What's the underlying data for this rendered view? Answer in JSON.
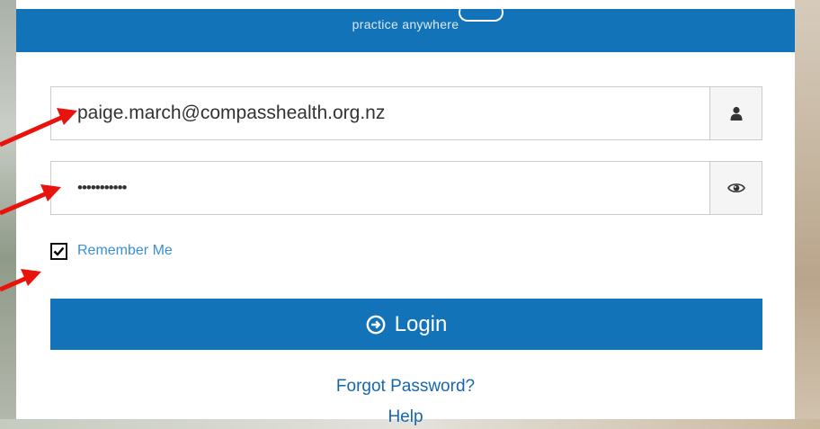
{
  "header": {
    "tagline": "practice anywhere"
  },
  "form": {
    "username_value": "paige.march@compasshealth.org.nz",
    "password_value": "•••••••••••",
    "remember_label": "Remember Me",
    "remember_checked": true,
    "login_label": "Login",
    "forgot_label": "Forgot Password?",
    "help_label": "Help"
  },
  "icons": {
    "username_addon": "user-icon",
    "password_addon": "eye-icon",
    "login": "circle-arrow-right-icon",
    "annotation": "red-arrow"
  },
  "colors": {
    "brand_blue": "#1273b9",
    "link_blue": "#1567b0",
    "remember_blue": "#3a8fd6",
    "annotation_red": "#e8130c"
  }
}
